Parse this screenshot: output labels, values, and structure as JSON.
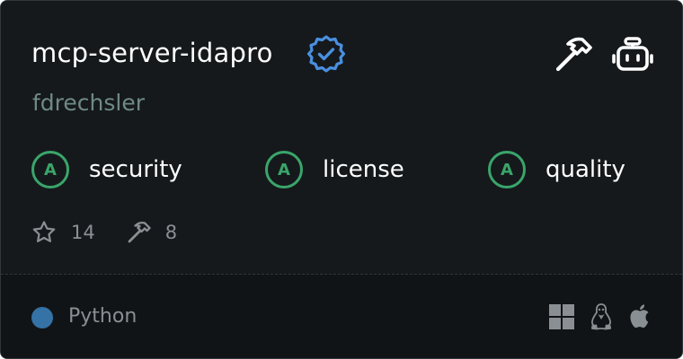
{
  "server": {
    "name": "mcp-server-idapro",
    "owner": "fdrechsler",
    "verified_icon": "verified-badge-icon"
  },
  "header_icons": [
    "hammer-icon",
    "robot-icon"
  ],
  "grades": [
    {
      "letter": "A",
      "label": "security"
    },
    {
      "letter": "A",
      "label": "license"
    },
    {
      "letter": "A",
      "label": "quality"
    }
  ],
  "stats": {
    "stars": "14",
    "tools": "8"
  },
  "footer": {
    "language": "Python",
    "language_color": "#3572a5",
    "platforms": [
      "windows-icon",
      "linux-icon",
      "apple-icon"
    ]
  },
  "colors": {
    "background": "#15191c",
    "grade_green": "#3aa56a",
    "verified_blue": "#4a8fe0",
    "muted_text": "#8a8f93"
  }
}
